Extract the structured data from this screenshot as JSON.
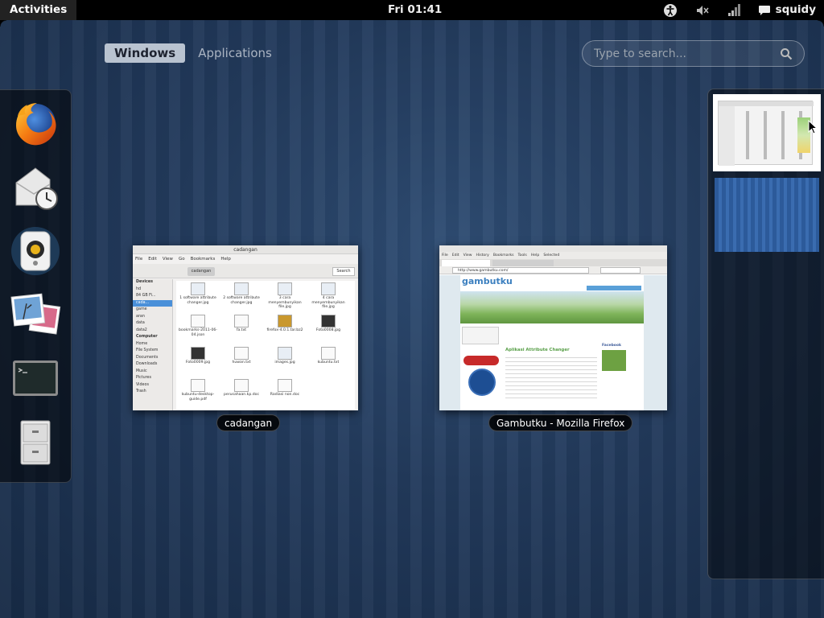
{
  "top_panel": {
    "activities_label": "Activities",
    "clock": "Fri 01:41",
    "icons": [
      "accessibility-icon",
      "volume-muted-icon",
      "network-signal-icon",
      "chat-icon"
    ],
    "user_name": "squidy"
  },
  "view_selector": {
    "tabs": [
      {
        "label": "Windows",
        "active": true
      },
      {
        "label": "Applications",
        "active": false
      }
    ]
  },
  "search": {
    "placeholder": "Type to search..."
  },
  "dash": {
    "items": [
      {
        "icon": "firefox-icon",
        "app": "Firefox"
      },
      {
        "icon": "evolution-mail-icon",
        "app": "Evolution"
      },
      {
        "icon": "rhythmbox-speaker-icon",
        "app": "Rhythmbox"
      },
      {
        "icon": "shotwell-photos-icon",
        "app": "Shotwell"
      },
      {
        "icon": "terminal-icon",
        "app": "Terminal"
      },
      {
        "icon": "file-cabinet-icon",
        "app": "Files"
      }
    ]
  },
  "windows": [
    {
      "caption": "cadangan",
      "titlebar": "cadangan",
      "menu": [
        "File",
        "Edit",
        "View",
        "Go",
        "Bookmarks",
        "Help"
      ],
      "location": "cadangan",
      "search_label": "Search",
      "sidebar": {
        "devices_header": "Devices",
        "devices": [
          "hd",
          "84 GB Fi...",
          "cada...",
          "game",
          "aran",
          "data",
          "data2"
        ],
        "computer_header": "Computer",
        "places": [
          "Home",
          "File System",
          "Documents",
          "Downloads",
          "Music",
          "Pictures",
          "Videos",
          "Trash"
        ]
      },
      "files": [
        "1 software attribute changer.jpg",
        "2 software attribute changer.jpg",
        "3 cara menyembunyikan file.jpg",
        "4 cara menyembunyikan file.jpg",
        "bookmarks-2011-06-04.json",
        "fa.txt",
        "firefox-4.0.1.tar.bz2",
        "Foto0008.jpg",
        "Foto0009.jpg",
        "huwan.txt",
        "images.jpg",
        "kubuntu.txt",
        "kubuntu-desktop-guide.pdf",
        "perusahaan.kp.doc",
        "Radiasi non.doc"
      ]
    },
    {
      "caption": "Gambutku - Mozilla Firefox",
      "menu": [
        "File",
        "Edit",
        "View",
        "History",
        "Bookmarks",
        "Tools",
        "Help",
        "Selected"
      ],
      "url": "http://www.gambutku.com/",
      "site_title": "gambutku",
      "post_title": "Aplikasi Attribute Changer",
      "sidebar_label": "Facebook"
    }
  ],
  "workspaces": [
    {
      "active": true
    },
    {
      "active": false
    }
  ],
  "colors": {
    "panel_bg": "#000000",
    "active_tab_bg": "#b9c3d0",
    "background": "#223a5c",
    "firefox_site_accent": "#3b7fbf"
  }
}
